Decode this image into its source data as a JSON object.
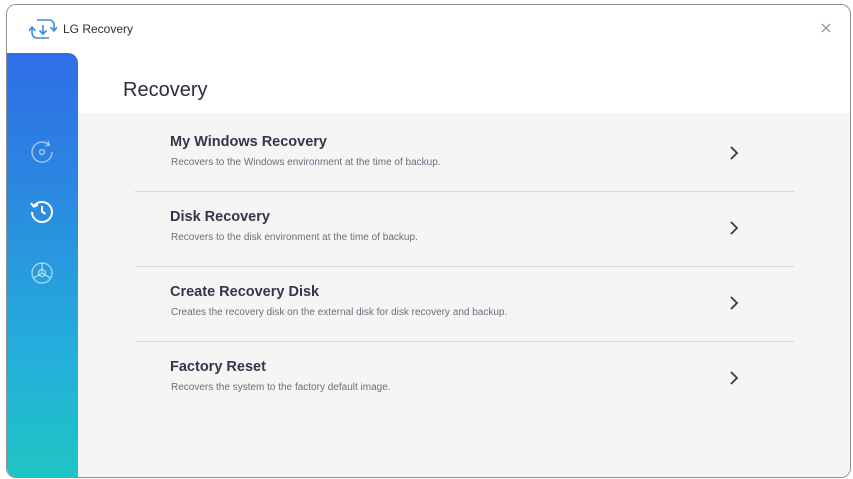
{
  "window": {
    "title": "LG Recovery",
    "logo_icon": "recovery-arrows-icon",
    "close_icon": "close-icon"
  },
  "sidebar": {
    "items": [
      {
        "name": "backup",
        "icon": "disc-backup-icon",
        "active": false
      },
      {
        "name": "recovery",
        "icon": "history-clock-icon",
        "active": true
      },
      {
        "name": "disk-usage",
        "icon": "pie-chart-icon",
        "active": false
      }
    ]
  },
  "main": {
    "title": "Recovery",
    "items": [
      {
        "title": "My Windows Recovery",
        "description": "Recovers to the Windows environment at the time of backup."
      },
      {
        "title": "Disk Recovery",
        "description": "Recovers to the disk environment at the time of backup."
      },
      {
        "title": "Create Recovery Disk",
        "description": "Creates the recovery disk on the external disk for disk recovery and backup."
      },
      {
        "title": "Factory Reset",
        "description": "Recovers the system to the factory default image."
      }
    ]
  },
  "colors": {
    "sidebar_top": "#2f6ee8",
    "sidebar_bottom": "#1fc5c5",
    "logo_blue": "#3a8de0",
    "content_bg": "#f5f5f6"
  }
}
